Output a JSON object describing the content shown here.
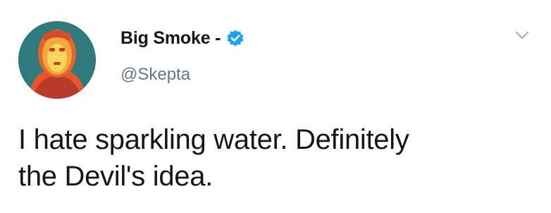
{
  "author": {
    "display_name": "Big Smoke -",
    "handle": "@Skepta",
    "verified": true,
    "avatar_icon": "profile-avatar-image"
  },
  "tweet": {
    "text_lines": [
      "I hate sparkling water. Definitely",
      "the Devil's idea."
    ]
  },
  "icons": {
    "verified": "verified-badge-icon",
    "menu": "chevron-down-icon"
  },
  "colors": {
    "verified_blue": "#1da1f2",
    "handle_gray": "#657786",
    "text": "#14171a",
    "chevron_gray": "#aab8c2"
  }
}
